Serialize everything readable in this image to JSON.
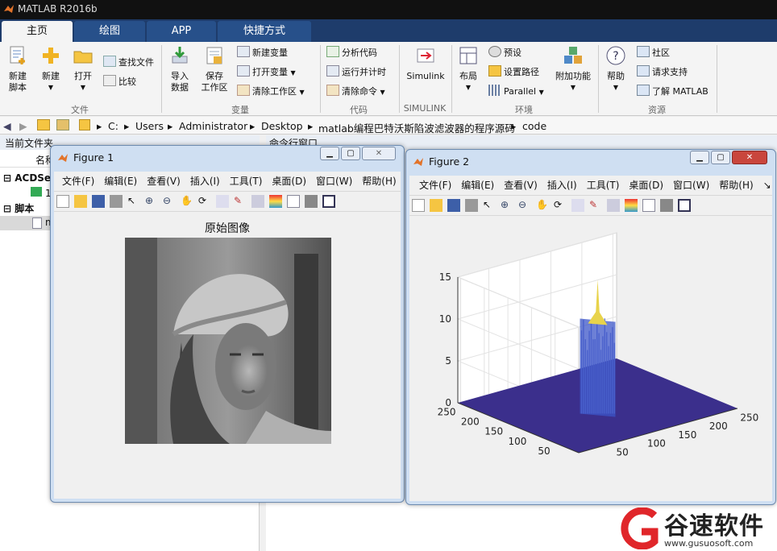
{
  "app": {
    "title": "MATLAB R2016b"
  },
  "tabs": [
    {
      "label": "主页"
    },
    {
      "label": "绘图"
    },
    {
      "label": "APP"
    },
    {
      "label": "快捷方式"
    }
  ],
  "ribbon": {
    "file": {
      "new_script": "新建\n脚本",
      "new": "新建",
      "open": "打开",
      "find_files": "查找文件",
      "compare": "比较",
      "group": "文件"
    },
    "variable": {
      "import": "导入\n数据",
      "save_ws": "保存\n工作区",
      "new_var": "新建变量",
      "open_var": "打开变量",
      "clear_ws": "清除工作区",
      "group": "变量"
    },
    "code": {
      "analyze": "分析代码",
      "run_time": "运行并计时",
      "clear_cmds": "清除命令",
      "group": "代码"
    },
    "simulink": {
      "simulink": "Simulink",
      "group": "SIMULINK"
    },
    "env": {
      "layout": "布局",
      "prefs": "预设",
      "set_path": "设置路径",
      "parallel": "Parallel",
      "addons": "附加功能",
      "group": "环境"
    },
    "resources": {
      "help": "帮助",
      "community": "社区",
      "request_support": "请求支持",
      "learn": "了解 MATLAB",
      "group": "资源"
    }
  },
  "address": {
    "path": [
      "C:",
      "Users",
      "Administrator",
      "Desktop",
      "matlab编程巴特沃斯陷波滤波器的程序源码",
      "code"
    ]
  },
  "left_panel": {
    "title": "当前文件夹",
    "col_name": "名称",
    "items": [
      "ACDSee",
      "1",
      "脚本",
      "m"
    ]
  },
  "cmd": {
    "title": "命令行窗口"
  },
  "figure1": {
    "title": "Figure 1",
    "menu": [
      "文件(F)",
      "编辑(E)",
      "查看(V)",
      "插入(I)",
      "工具(T)",
      "桌面(D)",
      "窗口(W)",
      "帮助(H)"
    ],
    "axes_title": "原始图像"
  },
  "figure2": {
    "title": "Figure 2",
    "menu": [
      "文件(F)",
      "编辑(E)",
      "查看(V)",
      "插入(I)",
      "工具(T)",
      "桌面(D)",
      "窗口(W)",
      "帮助(H)"
    ]
  },
  "chart_data": {
    "type": "surface",
    "title": "",
    "zlim": [
      0,
      15
    ],
    "z_ticks": [
      "0",
      "5",
      "10",
      "15"
    ],
    "x_ticks": [
      "50",
      "100",
      "150",
      "200",
      "250"
    ],
    "y_ticks": [
      "50",
      "100",
      "150",
      "200",
      "250"
    ],
    "peak_value": 15,
    "plateau_value": 10,
    "grid": "on",
    "colors": {
      "base": "#3b2f8c",
      "plateau": "#3c55c8",
      "top": "#e8d34b"
    }
  },
  "watermark": {
    "brand": "谷速软件",
    "url": "www.gusuosoft.com"
  },
  "colors": {
    "tabbar": "#1e3c6b",
    "accent": "#27508a",
    "figure_bg": "#f0f0f0",
    "surface_base": "#35307f"
  }
}
